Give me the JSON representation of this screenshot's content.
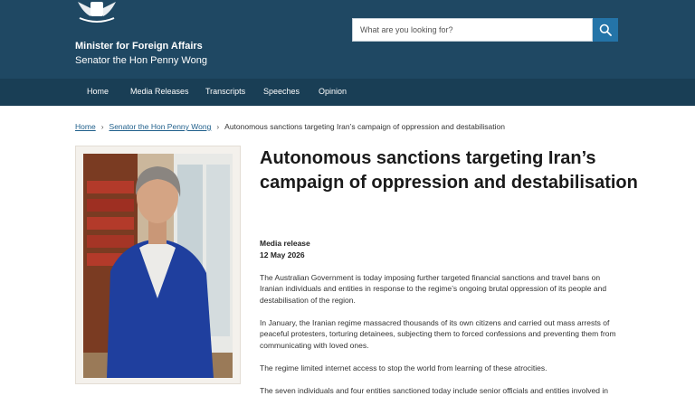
{
  "header": {
    "minister_title": "Minister for Foreign Affairs",
    "senator_name": "Senator the Hon Penny Wong",
    "search_placeholder": "What are you looking for?",
    "search_icon": "search-icon",
    "background_color": "#1f4863"
  },
  "nav": {
    "items": [
      {
        "label": "Home"
      },
      {
        "label": "Media Releases"
      },
      {
        "label": "Transcripts"
      },
      {
        "label": "Speeches"
      },
      {
        "label": "Opinion"
      }
    ],
    "background_color": "#193e55"
  },
  "breadcrumb": {
    "home": "Home",
    "senator": "Senator the Hon Penny Wong",
    "current": "Autonomous sanctions targeting Iran’s campaign of oppression and destabilisation"
  },
  "article": {
    "title": "Autonomous sanctions targeting Iran’s campaign of oppression and destabilisation",
    "type_label": "Media release",
    "date": "12 May 2026",
    "paragraphs": [
      "The Australian Government is today imposing further targeted financial sanctions and travel bans on Iranian individuals and entities in response to the regime’s ongoing brutal oppression of its people and destabilisation of the region.",
      "In January, the Iranian regime massacred thousands of its own citizens and carried out mass arrests of peaceful protesters, torturing detainees, subjecting them to forced confessions and preventing them from communicating with loved ones.",
      "The regime limited internet access to stop the world from learning of these atrocities.",
      "The seven individuals and four entities sanctioned today include senior officials and entities involved in"
    ]
  }
}
